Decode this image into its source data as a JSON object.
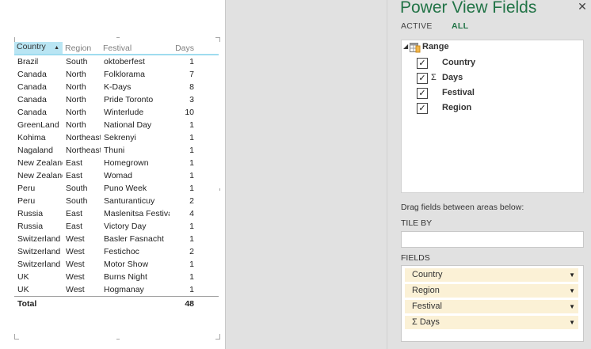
{
  "table": {
    "columns": [
      "Country",
      "Region",
      "Festival",
      "Days"
    ],
    "rows": [
      [
        "Brazil",
        "South",
        "oktoberfest",
        "1"
      ],
      [
        "Canada",
        "North",
        "Folklorama",
        "7"
      ],
      [
        "Canada",
        "North",
        "K-Days",
        "8"
      ],
      [
        "Canada",
        "North",
        "Pride Toronto",
        "3"
      ],
      [
        "Canada",
        "North",
        "Winterlude",
        "10"
      ],
      [
        "GreenLand",
        "North",
        "National Day",
        "1"
      ],
      [
        "Kohima",
        "Northeast",
        "Sekrenyi",
        "1"
      ],
      [
        "Nagaland",
        "Northeast",
        "Thuni",
        "1"
      ],
      [
        "New Zealand",
        "East",
        "Homegrown",
        "1"
      ],
      [
        "New Zealand",
        "East",
        "Womad",
        "1"
      ],
      [
        "Peru",
        "South",
        "Puno Week",
        "1"
      ],
      [
        "Peru",
        "South",
        "Santuranticuy",
        "2"
      ],
      [
        "Russia",
        "East",
        "Maslenitsa Festival",
        "4"
      ],
      [
        "Russia",
        "East",
        "Victory Day",
        "1"
      ],
      [
        "Switzerland",
        "West",
        "Basler Fasnacht",
        "1"
      ],
      [
        "Switzerland",
        "West",
        "Festichoc",
        "2"
      ],
      [
        "Switzerland",
        "West",
        "Motor Show",
        "1"
      ],
      [
        "UK",
        "West",
        "Burns Night",
        "1"
      ],
      [
        "UK",
        "West",
        "Hogmanay",
        "1"
      ]
    ],
    "total_label": "Total",
    "total_value": "48",
    "sorted_column": "Country",
    "sort_arrow": "▲"
  },
  "panel": {
    "title": "Power View Fields",
    "close_glyph": "✕",
    "tab_active": "ACTIVE",
    "tab_all": "ALL",
    "expand_glyph": "◢",
    "table_name": "Range",
    "fields": [
      {
        "label": "Country",
        "checked": "✓",
        "sigma": ""
      },
      {
        "label": "Days",
        "checked": "✓",
        "sigma": "Σ"
      },
      {
        "label": "Festival",
        "checked": "✓",
        "sigma": ""
      },
      {
        "label": "Region",
        "checked": "✓",
        "sigma": ""
      }
    ],
    "drag_hint": "Drag fields between areas below:",
    "tile_by_label": "TILE BY",
    "fields_label": "FIELDS",
    "area_fields": [
      "Country",
      "Region",
      "Festival",
      "Σ Days"
    ],
    "dropdown_glyph": "▼"
  },
  "colors": {
    "accent": "#217346",
    "header_underline": "#9fdcef",
    "sorted_header": "#b9e5f3",
    "field_chip": "#fbf1d6"
  }
}
